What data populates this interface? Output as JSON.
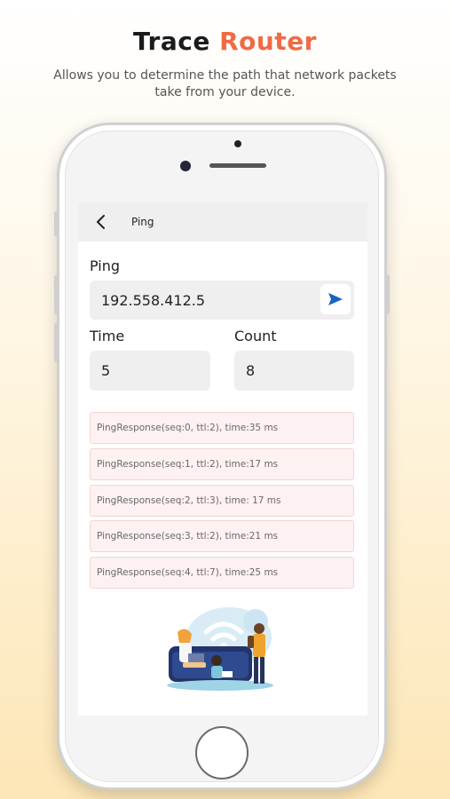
{
  "header": {
    "title_part1": "Trace",
    "title_part2": "Router",
    "subtitle": "Allows you to determine the path that network packets take from your device."
  },
  "app": {
    "title": "Ping",
    "back_icon": "chevron-left-icon",
    "ping_label": "Ping",
    "ping_value": "192.558.412.5",
    "send_icon": "send-icon",
    "time_label": "Time",
    "time_value": "5",
    "count_label": "Count",
    "count_value": "8",
    "responses": [
      "PingResponse(seq:0, ttl:2), time:35 ms",
      "PingResponse(seq:1, ttl:2), time:17 ms",
      "PingResponse(seq:2, ttl:3), time: 17 ms",
      "PingResponse(seq:3, ttl:2), time:21 ms",
      "PingResponse(seq:4, ttl:7), time:25 ms"
    ]
  },
  "colors": {
    "accent": "#f06a45",
    "send": "#1565c0",
    "response_bg": "#fdf1f1",
    "field_bg": "#efefef"
  }
}
